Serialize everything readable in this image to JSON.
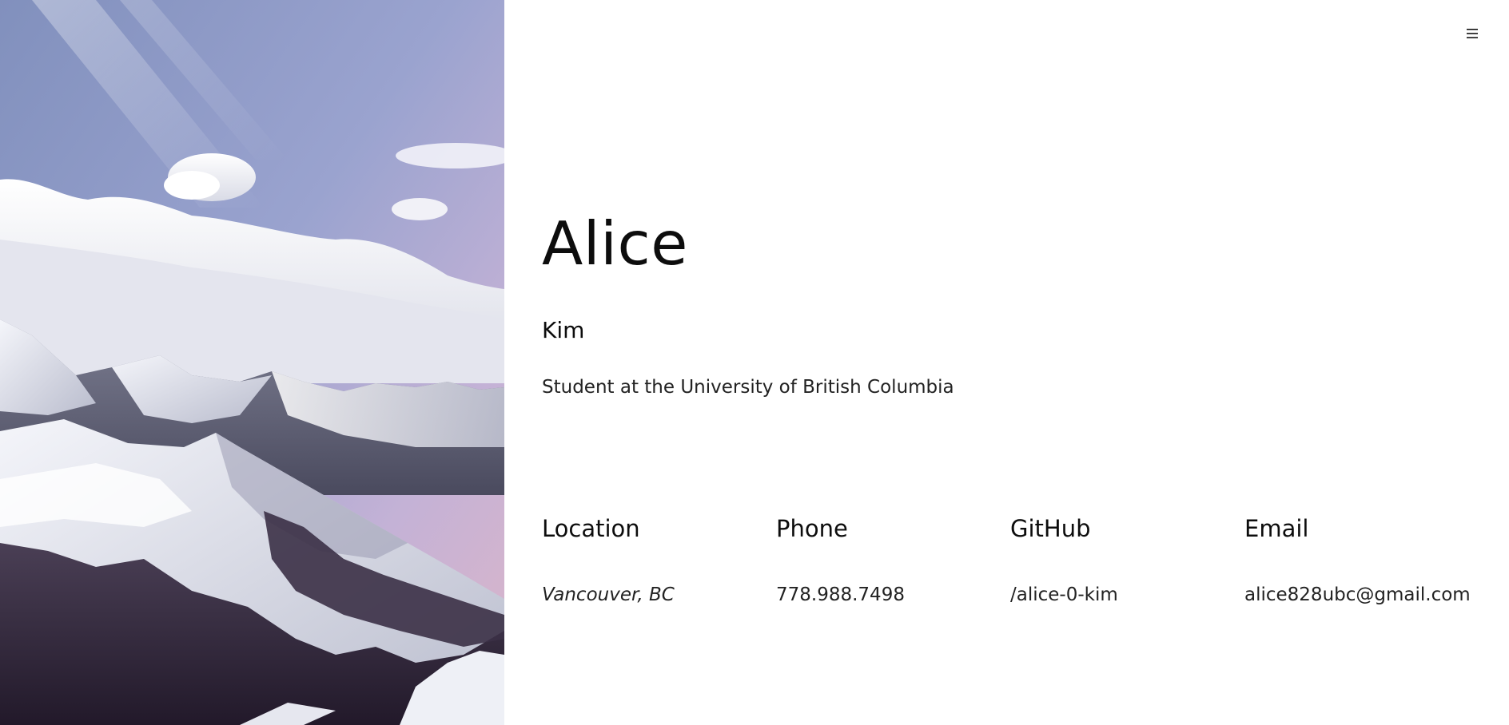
{
  "header": {
    "menu_icon": "hamburger-menu-icon"
  },
  "hero": {
    "first_name": "Alice",
    "last_name": "Kim",
    "tagline": "Student at the University of British Columbia"
  },
  "info": [
    {
      "heading": "Location",
      "value": "Vancouver, BC"
    },
    {
      "heading": "Phone",
      "value": "778.988.7498"
    },
    {
      "heading": "GitHub",
      "value": "/alice-0-kim"
    },
    {
      "heading": "Email",
      "value": "alice828ubc@gmail.com"
    }
  ],
  "colors": {
    "background": "#ffffff",
    "text": "#111111",
    "sky_top": "#7f8fc0",
    "sky_pink": "#d9b0cc",
    "forest": "#2e2433"
  }
}
